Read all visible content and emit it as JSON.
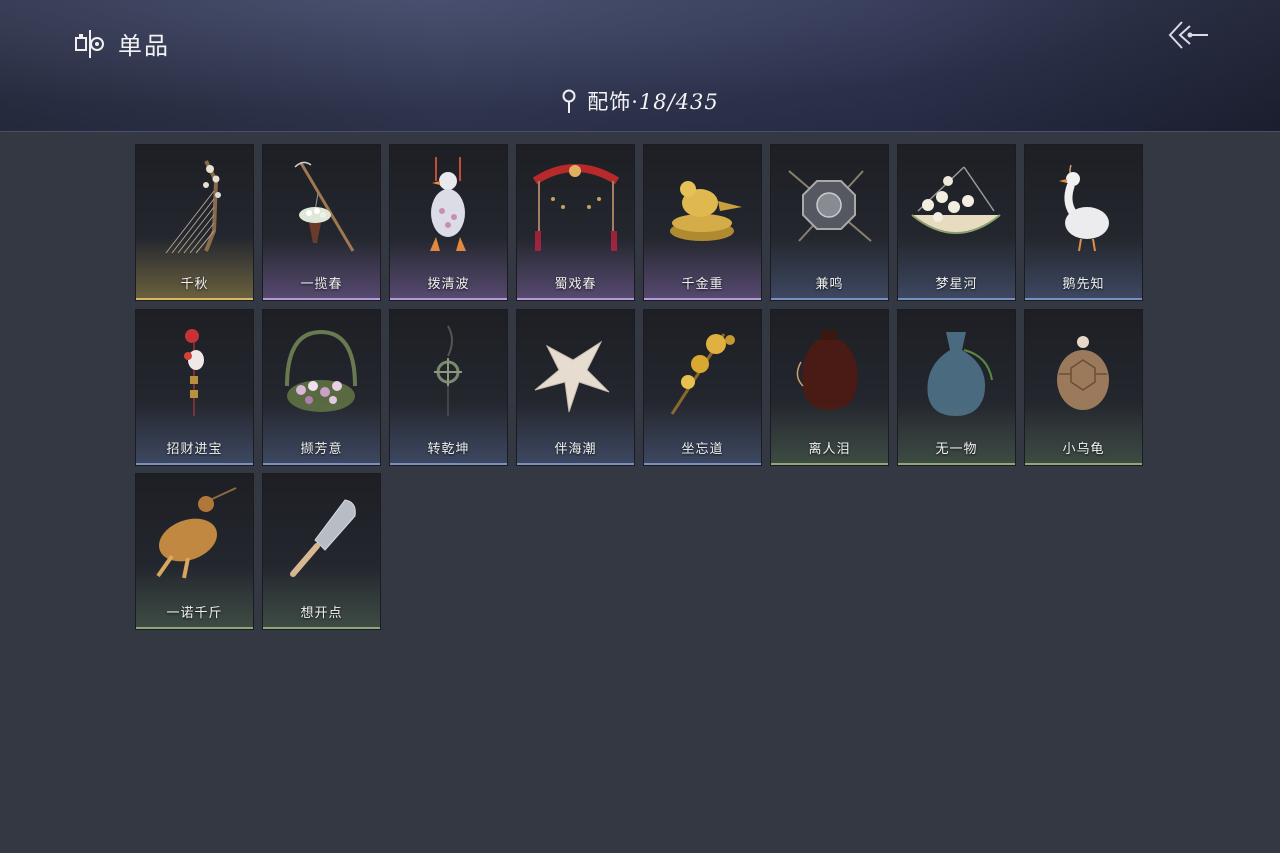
{
  "header": {
    "title": "单品",
    "category": "配饰",
    "separator": "·",
    "count": "18/435"
  },
  "items": [
    {
      "name": "千秋",
      "tier": "gold",
      "icon": "qin-instrument-icon"
    },
    {
      "name": "一揽春",
      "tier": "purple",
      "icon": "flower-basket-pole-icon"
    },
    {
      "name": "拨清波",
      "tier": "purple",
      "icon": "duck-toy-icon"
    },
    {
      "name": "蜀戏春",
      "tier": "purple",
      "icon": "stage-arch-icon"
    },
    {
      "name": "千金重",
      "tier": "purple",
      "icon": "golden-bird-icon"
    },
    {
      "name": "兼鸣",
      "tier": "blue",
      "icon": "octagon-drum-icon"
    },
    {
      "name": "梦星河",
      "tier": "blue",
      "icon": "flower-swing-icon"
    },
    {
      "name": "鹅先知",
      "tier": "blue",
      "icon": "goose-icon"
    },
    {
      "name": "招财进宝",
      "tier": "blue",
      "icon": "lucky-charm-icon"
    },
    {
      "name": "撷芳意",
      "tier": "blue",
      "icon": "flower-basket-icon"
    },
    {
      "name": "转乾坤",
      "tier": "blue",
      "icon": "compass-pendant-icon"
    },
    {
      "name": "伴海潮",
      "tier": "blue",
      "icon": "starfish-icon"
    },
    {
      "name": "坐忘道",
      "tier": "blue",
      "icon": "golden-flower-hairpin-icon"
    },
    {
      "name": "离人泪",
      "tier": "green",
      "icon": "wine-jar-icon"
    },
    {
      "name": "无一物",
      "tier": "green",
      "icon": "cloth-pouch-icon"
    },
    {
      "name": "小乌龟",
      "tier": "green",
      "icon": "turtle-icon"
    },
    {
      "name": "一诺千斤",
      "tier": "green",
      "icon": "roast-chicken-icon"
    },
    {
      "name": "想开点",
      "tier": "green",
      "icon": "cleaver-knife-icon"
    }
  ]
}
